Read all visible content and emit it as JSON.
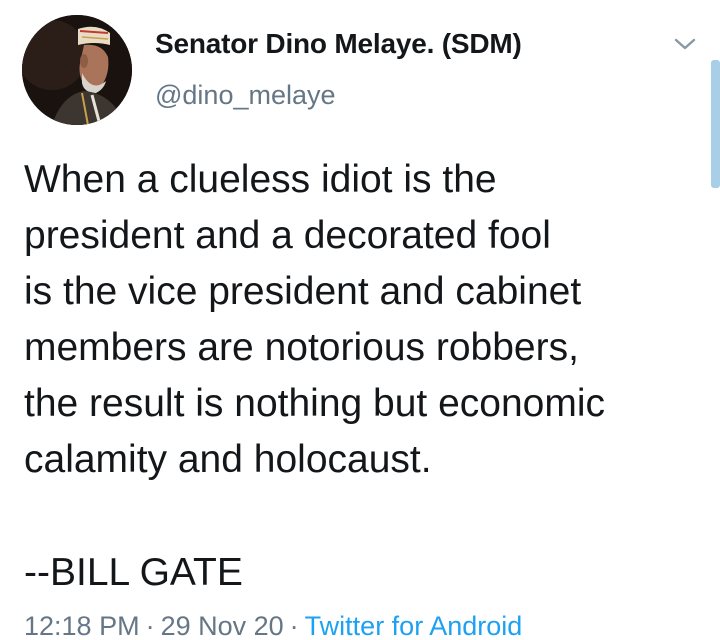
{
  "author": {
    "display_name": "Senator Dino Melaye. (SDM)",
    "handle": "@dino_melaye"
  },
  "tweet": {
    "text": "When a clueless idiot is the\npresident and a decorated fool\nis the vice president and cabinet\nmembers are notorious robbers,\nthe result is nothing but economic\ncalamity and holocaust.",
    "attribution": "--BILL GATE"
  },
  "meta": {
    "time": "12:18 PM",
    "separator": "·",
    "date": "29 Nov 20",
    "source": "Twitter for Android"
  },
  "colors": {
    "text_primary": "#14171a",
    "text_secondary": "#657786",
    "link": "#1da1f2",
    "scrollbar": "#a9cfe8"
  },
  "icons": {
    "menu": "chevron-down-icon"
  }
}
